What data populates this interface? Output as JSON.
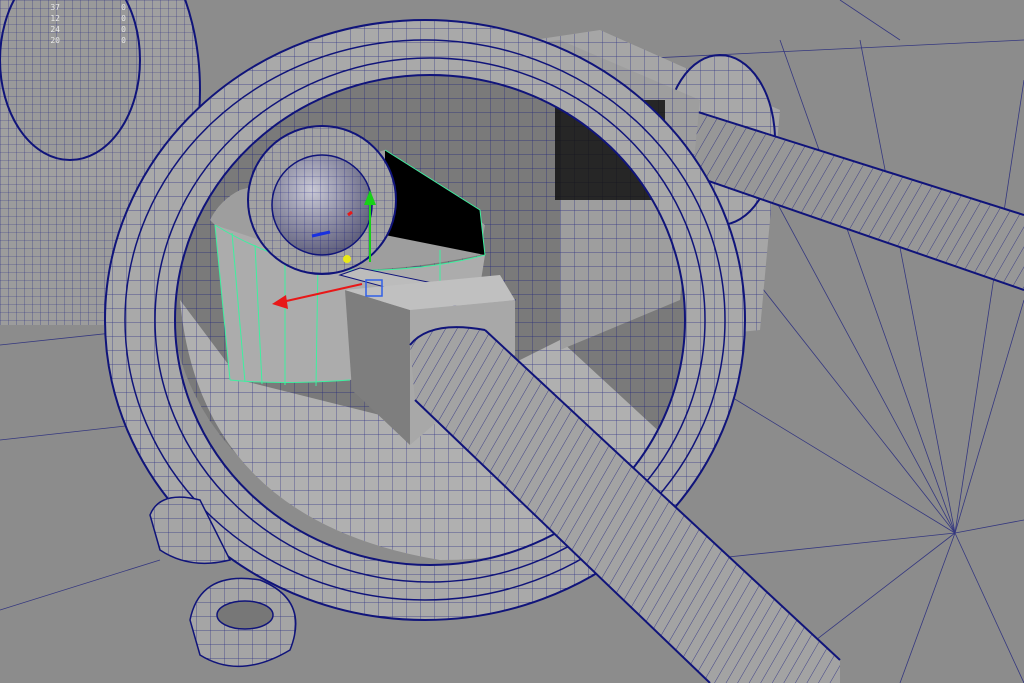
{
  "viewport": {
    "background": "#8c8c8c",
    "mesh_fill": "#a4a4a4",
    "mesh_shadow": "#6e6e6e",
    "wire_color": "#10147a",
    "selection_wire_color": "#3ef0a0",
    "manipulator": {
      "x_axis_color": "#e81818",
      "y_axis_color": "#18d018",
      "z_axis_color": "#1830e0",
      "center_color": "#e8e818"
    }
  },
  "hud": {
    "stats": [
      {
        "label": "37",
        "value": "0"
      },
      {
        "label": "12",
        "value": "0"
      },
      {
        "label": "24",
        "value": "0"
      },
      {
        "label": "20",
        "value": "0"
      }
    ]
  },
  "icons": {
    "manipulator": "move-manipulator-icon"
  }
}
